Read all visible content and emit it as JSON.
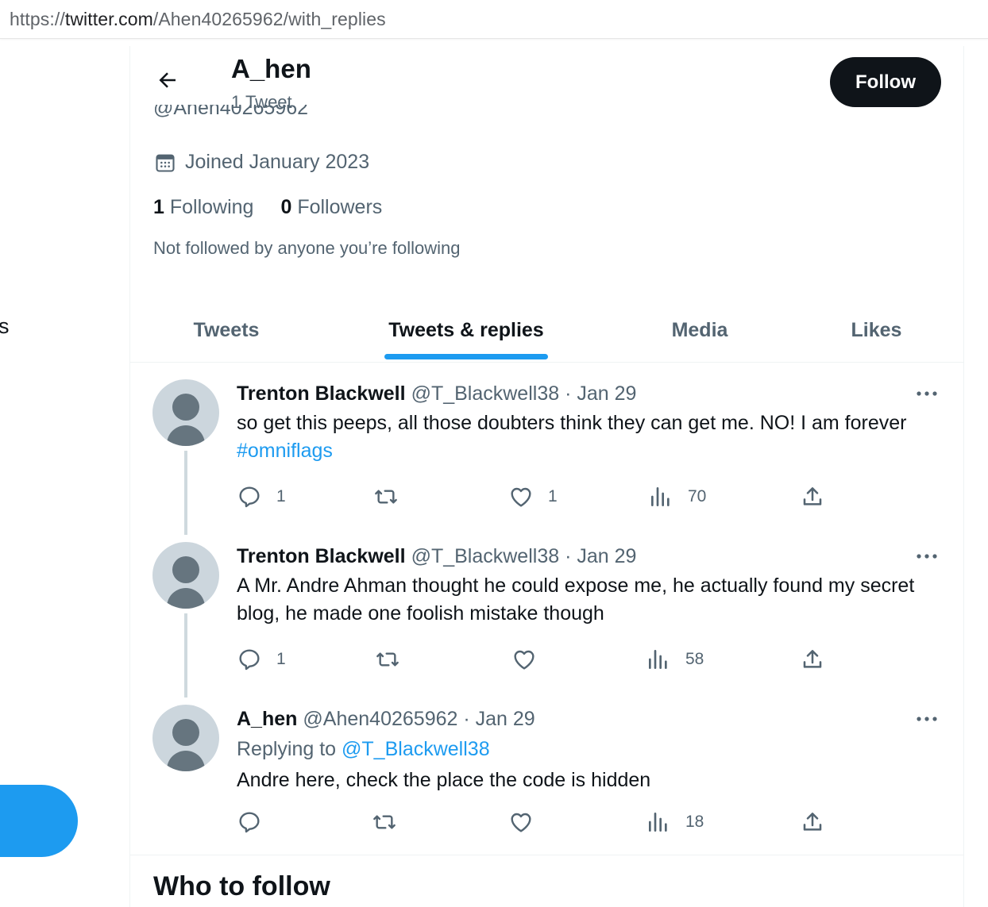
{
  "browser": {
    "url_prefix": "https://",
    "url_host": "twitter.com",
    "url_path": "/Ahen40265962/with_replies"
  },
  "sidebar": {
    "partial_label": "s"
  },
  "header": {
    "name": "A_hen",
    "tweet_count": "1 Tweet",
    "handle_clipped": "@Ahen40265962",
    "follow_label": "Follow"
  },
  "profile": {
    "joined": "Joined January 2023",
    "following_count": "1",
    "following_label": " Following",
    "followers_count": "0",
    "followers_label": " Followers",
    "not_followed": "Not followed by anyone you’re following"
  },
  "tabs": [
    {
      "label": "Tweets",
      "active": false
    },
    {
      "label": "Tweets & replies",
      "active": true
    },
    {
      "label": "Media",
      "active": false
    },
    {
      "label": "Likes",
      "active": false
    }
  ],
  "tweets": [
    {
      "name": "Trenton Blackwell",
      "handle": "@T_Blackwell38",
      "date": "Jan 29",
      "text_before": "so get this peeps, all those doubters think they can get me. NO! I am forever ",
      "hashtag": "#omniflags",
      "reply_count": "1",
      "retweet_count": "",
      "like_count": "1",
      "view_count": "70"
    },
    {
      "name": "Trenton Blackwell",
      "handle": "@T_Blackwell38",
      "date": "Jan 29",
      "text": "A Mr. Andre Ahman thought he could expose me, he actually found my secret blog, he made one foolish mistake though",
      "reply_count": "1",
      "retweet_count": "",
      "like_count": "",
      "view_count": "58"
    },
    {
      "name": "A_hen",
      "handle": "@Ahen40265962",
      "date": "Jan 29",
      "replying_prefix": "Replying to ",
      "replying_to": "@T_Blackwell38",
      "text": "Andre here, check the place the code is hidden",
      "reply_count": "",
      "retweet_count": "",
      "like_count": "",
      "view_count": "18"
    }
  ],
  "who_to_follow": "Who to follow",
  "separator": "·",
  "colors": {
    "accent": "#1d9bf0",
    "text_primary": "#0f1419",
    "text_secondary": "#536471",
    "avatar_bg": "#ccd6dd",
    "avatar_fg": "#66757f",
    "follow_bg": "#0f1419"
  },
  "icons": {
    "back": "arrow-left-icon",
    "calendar": "calendar-icon",
    "more": "more-dots-icon",
    "reply": "reply-icon",
    "retweet": "retweet-icon",
    "like": "heart-icon",
    "views": "views-icon",
    "share": "share-icon"
  }
}
